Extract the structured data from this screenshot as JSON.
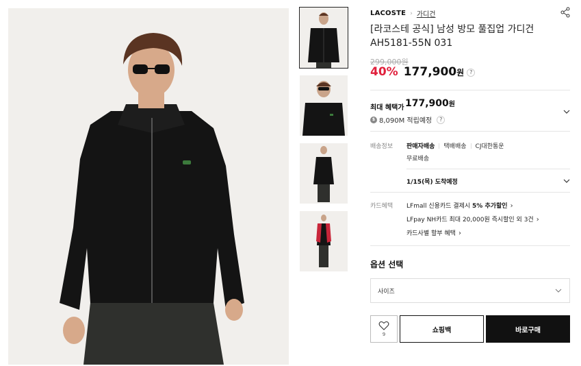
{
  "breadcrumb": {
    "brand": "LACOSTE",
    "separator": "›",
    "category": "가디건"
  },
  "product": {
    "title": "[라코스테 공식] 남성 방모 풀집업 가디건 AH5181-55N 031",
    "original_price": "299,000원",
    "discount": "40%",
    "sale_price": "177,900",
    "won": "원"
  },
  "benefit": {
    "label": "최대 혜택가",
    "price": "177,900",
    "won": "원",
    "coin": "$",
    "points": "8,090M 적립예정"
  },
  "shipping": {
    "label": "배송정보",
    "type": "판매자배송",
    "method": "택배배송",
    "carrier": "CJ대한통운",
    "fee": "무료배송",
    "arrival": "1/15(목) 도착예정"
  },
  "card": {
    "label": "카드혜택",
    "line1_pre": "LFmall 신용카드 결제시 ",
    "line1_bold": "5% 추가할인",
    "line2": "LFpay NH카드 최대 20,000원 즉시할인 외 3건",
    "line3": "카드사별 할부 혜택"
  },
  "option": {
    "title": "옵션 선택",
    "size_placeholder": "사이즈"
  },
  "actions": {
    "wish_count": "9",
    "cart_label": "쇼핑백",
    "buy_label": "바로구매"
  },
  "help_mark": "?",
  "colors": {
    "discount": "#e0203c",
    "buy_bg": "#111111",
    "image_bg": "#f1efec",
    "garment": "#141414"
  }
}
